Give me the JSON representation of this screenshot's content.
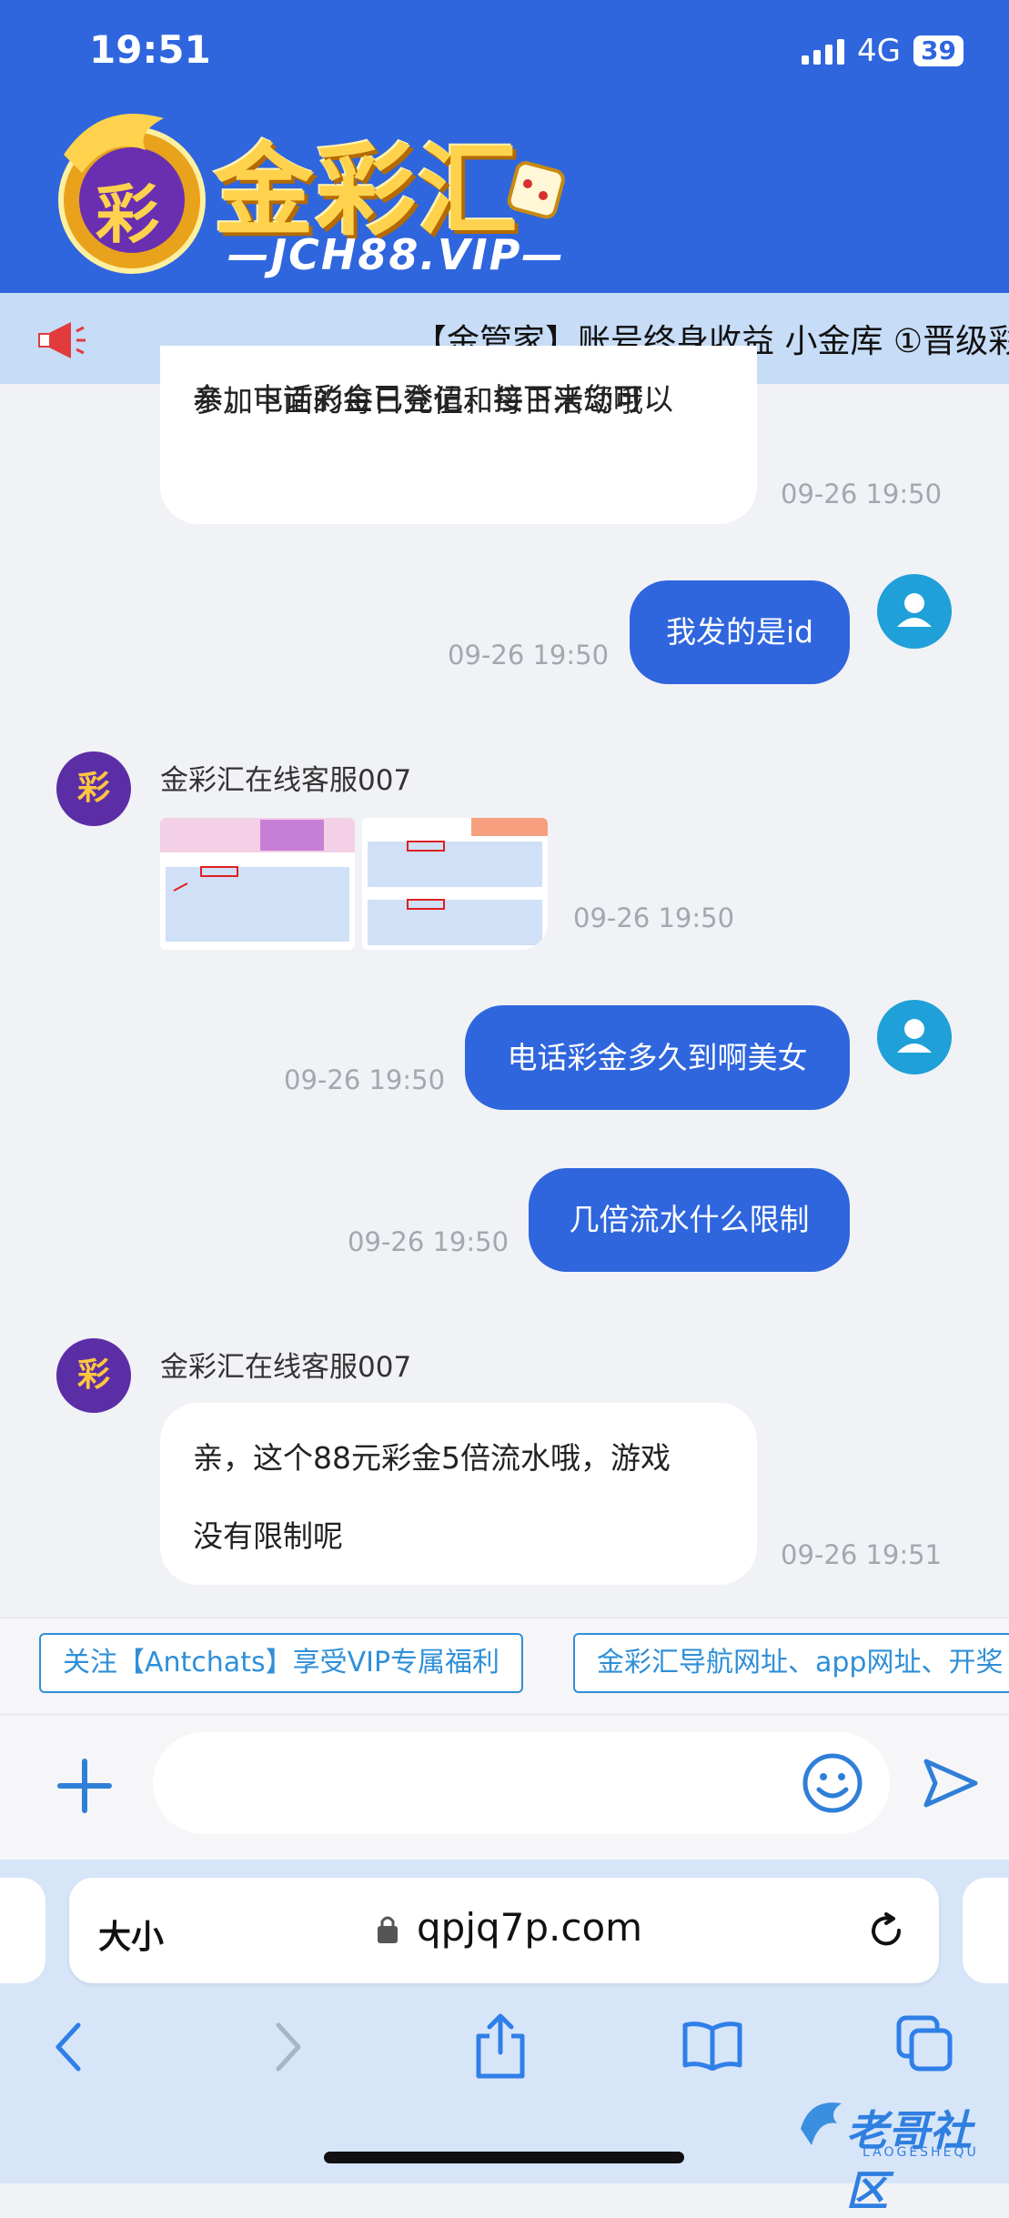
{
  "status": {
    "time": "19:51",
    "network": "4G",
    "battery": "39"
  },
  "brand": {
    "name": "金彩汇",
    "domain": "—JCH88.VIP—",
    "badge": "彩"
  },
  "marquee": {
    "text": "【金管家】账号终身收益 小金库 ①晋级彩"
  },
  "messages": [
    {
      "type": "incoming-text",
      "lines": [
        "亲，电话彩金已登记，接下来您可以",
        "参加下面的每日充值和每日活动哦"
      ],
      "time": "09-26 19:50"
    },
    {
      "type": "outgoing",
      "text": "我发的是id",
      "time": "09-26 19:50"
    },
    {
      "type": "incoming-images",
      "sender": "金彩汇在线客服007",
      "time": "09-26 19:50"
    },
    {
      "type": "outgoing",
      "text": "电话彩金多久到啊美女",
      "time": "09-26 19:50"
    },
    {
      "type": "outgoing",
      "text": "几倍流水什么限制",
      "time": "09-26 19:50"
    },
    {
      "type": "incoming-text",
      "sender": "金彩汇在线客服007",
      "lines": [
        "亲，这个88元彩金5倍流水哦，游戏",
        "没有限制呢"
      ],
      "time": "09-26 19:51"
    }
  ],
  "quick_replies": [
    "关注【Antchats】享受VIP专属福利",
    "金彩汇导航网址、app网址、开奖"
  ],
  "input": {
    "placeholder": ""
  },
  "browser": {
    "text_size": "大小",
    "url": "qpjq7p.com"
  },
  "watermark": {
    "text": "老哥社区",
    "sub": "LAOGESHEQU"
  },
  "colors": {
    "primary": "#2f66dd",
    "avatar_user": "#1fa0d8",
    "chip": "#2f8fd8"
  }
}
